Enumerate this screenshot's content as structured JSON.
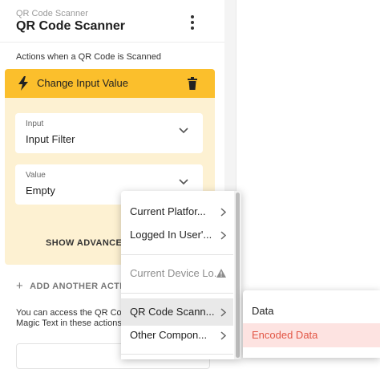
{
  "header": {
    "subtitle": "QR Code Scanner",
    "title": "QR Code Scanner"
  },
  "actions_section": {
    "label": "Actions when a QR Code is Scanned"
  },
  "action_card": {
    "title": "Change Input Value",
    "input_field": {
      "label": "Input",
      "value": "Input Filter"
    },
    "value_field": {
      "label": "Value",
      "value": "Empty"
    },
    "show_advanced": "SHOW ADVANCED"
  },
  "add_action": {
    "label": "ADD ANOTHER ACTIO"
  },
  "info": {
    "line1": "You can access the QR Cod",
    "line2": "Magic Text in these actions"
  },
  "menu": {
    "items": [
      {
        "label": "Current Platfor...",
        "has_submenu": true
      },
      {
        "label": "Logged In User'...",
        "has_submenu": true
      },
      {
        "label": "Current Device Lo...",
        "disabled": true,
        "warning": true
      },
      {
        "label": "QR Code Scann...",
        "has_submenu": true,
        "highlighted": true
      },
      {
        "label": "Other Compon...",
        "has_submenu": true
      }
    ]
  },
  "submenu": {
    "items": [
      {
        "label": "Data"
      },
      {
        "label": "Encoded Data",
        "selected": true
      }
    ]
  },
  "colors": {
    "action_header": "#fbbf2c",
    "action_body": "#fdf1d2",
    "selected_text": "#e25544",
    "selected_bg": "#fde3e1",
    "highlight_bg": "#e9e9e9"
  }
}
